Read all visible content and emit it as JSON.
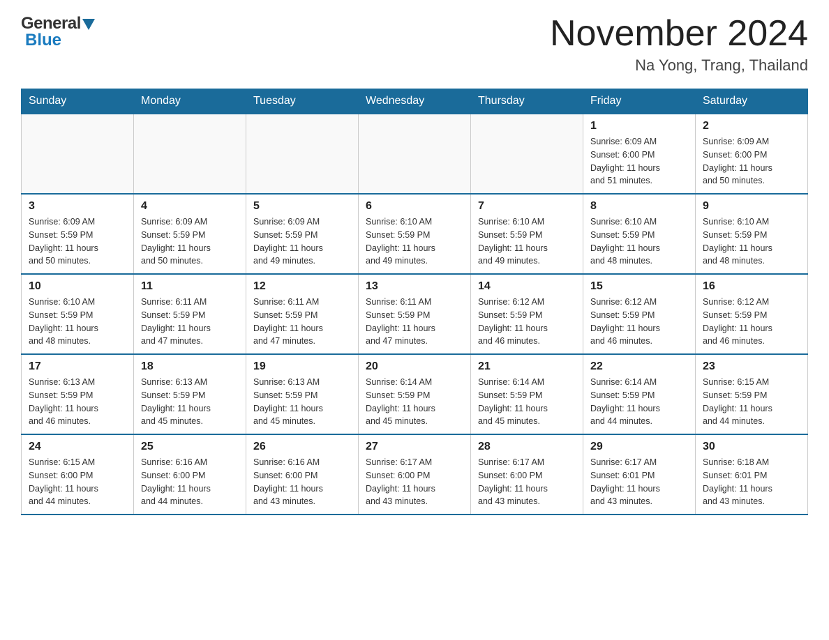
{
  "header": {
    "logo_general": "General",
    "logo_blue": "Blue",
    "month_title": "November 2024",
    "location": "Na Yong, Trang, Thailand"
  },
  "calendar": {
    "days_of_week": [
      "Sunday",
      "Monday",
      "Tuesday",
      "Wednesday",
      "Thursday",
      "Friday",
      "Saturday"
    ],
    "weeks": [
      [
        {
          "day": "",
          "info": ""
        },
        {
          "day": "",
          "info": ""
        },
        {
          "day": "",
          "info": ""
        },
        {
          "day": "",
          "info": ""
        },
        {
          "day": "",
          "info": ""
        },
        {
          "day": "1",
          "info": "Sunrise: 6:09 AM\nSunset: 6:00 PM\nDaylight: 11 hours\nand 51 minutes."
        },
        {
          "day": "2",
          "info": "Sunrise: 6:09 AM\nSunset: 6:00 PM\nDaylight: 11 hours\nand 50 minutes."
        }
      ],
      [
        {
          "day": "3",
          "info": "Sunrise: 6:09 AM\nSunset: 5:59 PM\nDaylight: 11 hours\nand 50 minutes."
        },
        {
          "day": "4",
          "info": "Sunrise: 6:09 AM\nSunset: 5:59 PM\nDaylight: 11 hours\nand 50 minutes."
        },
        {
          "day": "5",
          "info": "Sunrise: 6:09 AM\nSunset: 5:59 PM\nDaylight: 11 hours\nand 49 minutes."
        },
        {
          "day": "6",
          "info": "Sunrise: 6:10 AM\nSunset: 5:59 PM\nDaylight: 11 hours\nand 49 minutes."
        },
        {
          "day": "7",
          "info": "Sunrise: 6:10 AM\nSunset: 5:59 PM\nDaylight: 11 hours\nand 49 minutes."
        },
        {
          "day": "8",
          "info": "Sunrise: 6:10 AM\nSunset: 5:59 PM\nDaylight: 11 hours\nand 48 minutes."
        },
        {
          "day": "9",
          "info": "Sunrise: 6:10 AM\nSunset: 5:59 PM\nDaylight: 11 hours\nand 48 minutes."
        }
      ],
      [
        {
          "day": "10",
          "info": "Sunrise: 6:10 AM\nSunset: 5:59 PM\nDaylight: 11 hours\nand 48 minutes."
        },
        {
          "day": "11",
          "info": "Sunrise: 6:11 AM\nSunset: 5:59 PM\nDaylight: 11 hours\nand 47 minutes."
        },
        {
          "day": "12",
          "info": "Sunrise: 6:11 AM\nSunset: 5:59 PM\nDaylight: 11 hours\nand 47 minutes."
        },
        {
          "day": "13",
          "info": "Sunrise: 6:11 AM\nSunset: 5:59 PM\nDaylight: 11 hours\nand 47 minutes."
        },
        {
          "day": "14",
          "info": "Sunrise: 6:12 AM\nSunset: 5:59 PM\nDaylight: 11 hours\nand 46 minutes."
        },
        {
          "day": "15",
          "info": "Sunrise: 6:12 AM\nSunset: 5:59 PM\nDaylight: 11 hours\nand 46 minutes."
        },
        {
          "day": "16",
          "info": "Sunrise: 6:12 AM\nSunset: 5:59 PM\nDaylight: 11 hours\nand 46 minutes."
        }
      ],
      [
        {
          "day": "17",
          "info": "Sunrise: 6:13 AM\nSunset: 5:59 PM\nDaylight: 11 hours\nand 46 minutes."
        },
        {
          "day": "18",
          "info": "Sunrise: 6:13 AM\nSunset: 5:59 PM\nDaylight: 11 hours\nand 45 minutes."
        },
        {
          "day": "19",
          "info": "Sunrise: 6:13 AM\nSunset: 5:59 PM\nDaylight: 11 hours\nand 45 minutes."
        },
        {
          "day": "20",
          "info": "Sunrise: 6:14 AM\nSunset: 5:59 PM\nDaylight: 11 hours\nand 45 minutes."
        },
        {
          "day": "21",
          "info": "Sunrise: 6:14 AM\nSunset: 5:59 PM\nDaylight: 11 hours\nand 45 minutes."
        },
        {
          "day": "22",
          "info": "Sunrise: 6:14 AM\nSunset: 5:59 PM\nDaylight: 11 hours\nand 44 minutes."
        },
        {
          "day": "23",
          "info": "Sunrise: 6:15 AM\nSunset: 5:59 PM\nDaylight: 11 hours\nand 44 minutes."
        }
      ],
      [
        {
          "day": "24",
          "info": "Sunrise: 6:15 AM\nSunset: 6:00 PM\nDaylight: 11 hours\nand 44 minutes."
        },
        {
          "day": "25",
          "info": "Sunrise: 6:16 AM\nSunset: 6:00 PM\nDaylight: 11 hours\nand 44 minutes."
        },
        {
          "day": "26",
          "info": "Sunrise: 6:16 AM\nSunset: 6:00 PM\nDaylight: 11 hours\nand 43 minutes."
        },
        {
          "day": "27",
          "info": "Sunrise: 6:17 AM\nSunset: 6:00 PM\nDaylight: 11 hours\nand 43 minutes."
        },
        {
          "day": "28",
          "info": "Sunrise: 6:17 AM\nSunset: 6:00 PM\nDaylight: 11 hours\nand 43 minutes."
        },
        {
          "day": "29",
          "info": "Sunrise: 6:17 AM\nSunset: 6:01 PM\nDaylight: 11 hours\nand 43 minutes."
        },
        {
          "day": "30",
          "info": "Sunrise: 6:18 AM\nSunset: 6:01 PM\nDaylight: 11 hours\nand 43 minutes."
        }
      ]
    ]
  }
}
